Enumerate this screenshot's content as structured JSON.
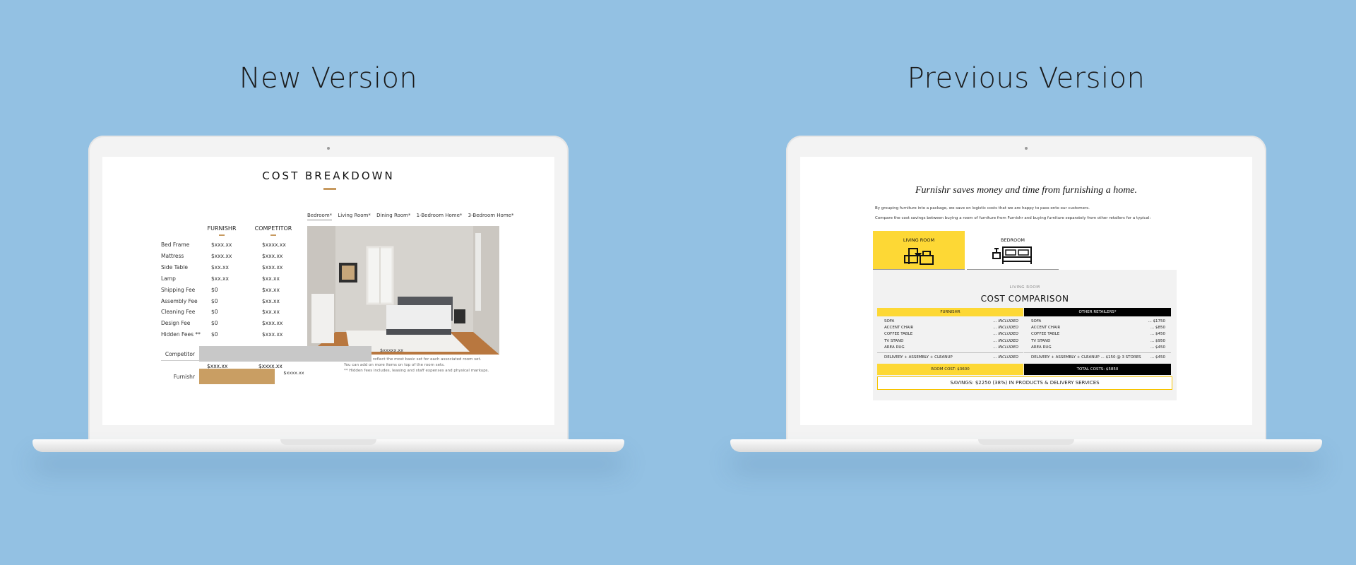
{
  "left": {
    "heading": "New Version",
    "title": "COST BREAKDOWN",
    "columns": [
      "FURNISHR",
      "COMPETITOR"
    ],
    "rows": [
      {
        "name": "Bed Frame",
        "furnishr": "$xxx.xx",
        "competitor": "$xxxx.xx"
      },
      {
        "name": "Mattress",
        "furnishr": "$xxx.xx",
        "competitor": "$xxx.xx"
      },
      {
        "name": "Side Table",
        "furnishr": "$xx.xx",
        "competitor": "$xxx.xx"
      },
      {
        "name": "Lamp",
        "furnishr": "$xx.xx",
        "competitor": "$xx.xx"
      },
      {
        "name": "Shipping Fee",
        "furnishr": "$0",
        "competitor": "$xx.xx"
      },
      {
        "name": "Assembly Fee",
        "furnishr": "$0",
        "competitor": "$xx.xx"
      },
      {
        "name": "Cleaning Fee",
        "furnishr": "$0",
        "competitor": "$xx.xx"
      },
      {
        "name": "Design Fee",
        "furnishr": "$0",
        "competitor": "$xxx.xx"
      },
      {
        "name": "Hidden Fees **",
        "furnishr": "$0",
        "competitor": "$xxx.xx"
      }
    ],
    "totals": {
      "furnishr": "$xxx.xx",
      "competitor": "$xxxx.xx"
    },
    "tabs": [
      "Bedroom*",
      "Living Room*",
      "Dining Room*",
      "1-Bedroom Home*",
      "3-Bedroom Home*"
    ],
    "notes": [
      "* These prices reflect the most basic set for each associated room set.",
      "You can add on more items on top of the room sets.",
      "** Hidden fees includes, leasing and staff expenses and physical markups."
    ],
    "bars": [
      {
        "label": "Competitor",
        "value_label": "$xxxxx.xx",
        "fraction": 1.0,
        "color": "#c8c8c8"
      },
      {
        "label": "Furnishr",
        "value_label": "$xxxx.xx",
        "fraction": 0.44,
        "color": "#c99e63"
      }
    ],
    "accent_color": "#c79a60"
  },
  "right": {
    "heading": "Previous Version",
    "headline": "Furnishr saves money and time from furnishing a home.",
    "intro1": "By grouping furniture into a package, we save on logistic costs that we are happy to pass onto our customers.",
    "intro2": "Compare the cost savings between buying a room of furniture from Furnishr and buying furniture separately from other retailers for a typical:",
    "tabs": [
      "LIVING ROOM",
      "BEDROOM"
    ],
    "panel_sub": "LIVING ROOM",
    "panel_title": "COST COMPARISON",
    "col_left": "FURNISHR",
    "col_right": "OTHER RETAILERS*",
    "items": [
      {
        "name": "SOFA",
        "left": "... INCLUDED",
        "right": "... $1750"
      },
      {
        "name": "ACCENT CHAIR",
        "left": "... INCLUDED",
        "right": "... $850"
      },
      {
        "name": "COFFEE TABLE",
        "left": "... INCLUDED",
        "right": "... $450"
      },
      {
        "name": "TV STAND",
        "left": "... INCLUDED",
        "right": "... $950"
      },
      {
        "name": "AREA RUG",
        "left": "... INCLUDED",
        "right": "... $450"
      }
    ],
    "delivery_left": "DELIVERY + ASSEMBLY + CLEANUP",
    "delivery_left_val": "... INCLUDED",
    "delivery_right": "DELIVERY + ASSEMBLY + CLEANUP ... $150 @ 3 STORES",
    "delivery_right_val": "... $450",
    "room_cost": "ROOM COST: $3600",
    "total_costs": "TOTAL COSTS: $5850",
    "savings": "SAVINGS: $2250 (38%) IN PRODUCTS & DELIVERY SERVICES",
    "accent_color": "#fdd835"
  }
}
